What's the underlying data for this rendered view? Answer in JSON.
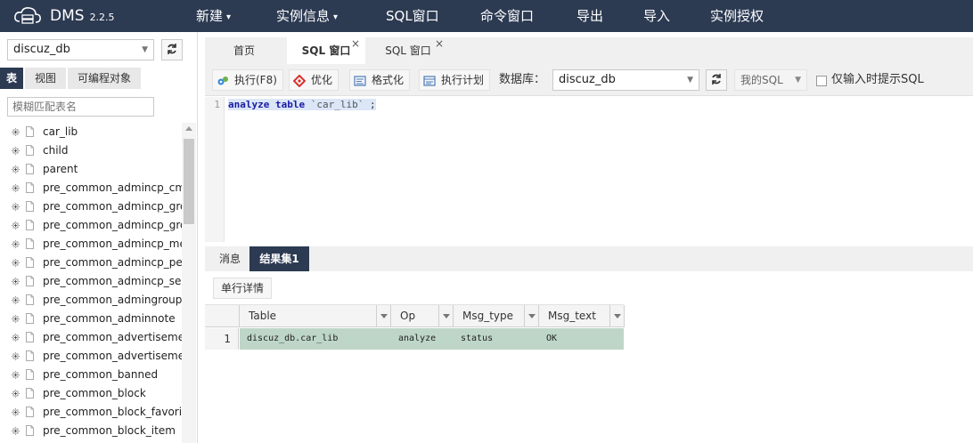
{
  "header": {
    "brand": "DMS",
    "version": "2.2.5",
    "menu": [
      {
        "label": "新建",
        "has_caret": true
      },
      {
        "label": "实例信息",
        "has_caret": true
      },
      {
        "label": "SQL窗口",
        "has_caret": false
      },
      {
        "label": "命令窗口",
        "has_caret": false
      },
      {
        "label": "导出",
        "has_caret": false
      },
      {
        "label": "导入",
        "has_caret": false
      },
      {
        "label": "实例授权",
        "has_caret": false
      }
    ],
    "caret_glyph": "▾"
  },
  "sidebar": {
    "database": "discuz_db",
    "tabs": [
      "表",
      "视图",
      "可编程对象"
    ],
    "active_tab": "表",
    "filter_placeholder": "模糊匹配表名",
    "tables": [
      "car_lib",
      "child",
      "parent",
      "pre_common_admincp_cmd",
      "pre_common_admincp_group",
      "pre_common_admincp_group",
      "pre_common_admincp_member",
      "pre_common_admincp_perm",
      "pre_common_admincp_session",
      "pre_common_admingroup",
      "pre_common_adminnote",
      "pre_common_advertisement",
      "pre_common_advertisement",
      "pre_common_banned",
      "pre_common_block",
      "pre_common_block_favorite",
      "pre_common_block_item"
    ]
  },
  "tabs": [
    {
      "label": "首页",
      "closable": false,
      "active": false
    },
    {
      "label": "SQL 窗口",
      "closable": true,
      "active": true
    },
    {
      "label": "SQL 窗口",
      "closable": true,
      "active": false
    }
  ],
  "close_glyph": "×",
  "toolbar": {
    "execute": "执行(F8)",
    "optimize": "优化",
    "format": "格式化",
    "plan": "执行计划",
    "db_label": "数据库：",
    "db_value": "discuz_db",
    "mysql": "我的SQL",
    "hint": "仅输入时提示SQL"
  },
  "editor": {
    "line_number": "1",
    "kw1": "analyze",
    "kw2": "table",
    "table_name": "`car_lib`",
    "terminator": ";"
  },
  "result": {
    "tabs": [
      "消息",
      "结果集1"
    ],
    "active_tab": "结果集1",
    "row_detail": "单行详情",
    "columns": [
      "Table",
      "Op",
      "Msg_type",
      "Msg_text"
    ],
    "rows": [
      {
        "num": "1",
        "cells": [
          "discuz_db.car_lib",
          "analyze",
          "status",
          "OK"
        ]
      }
    ]
  },
  "colors": {
    "header_bg": "#2c3a52",
    "selected_row": "#bed6c8"
  }
}
